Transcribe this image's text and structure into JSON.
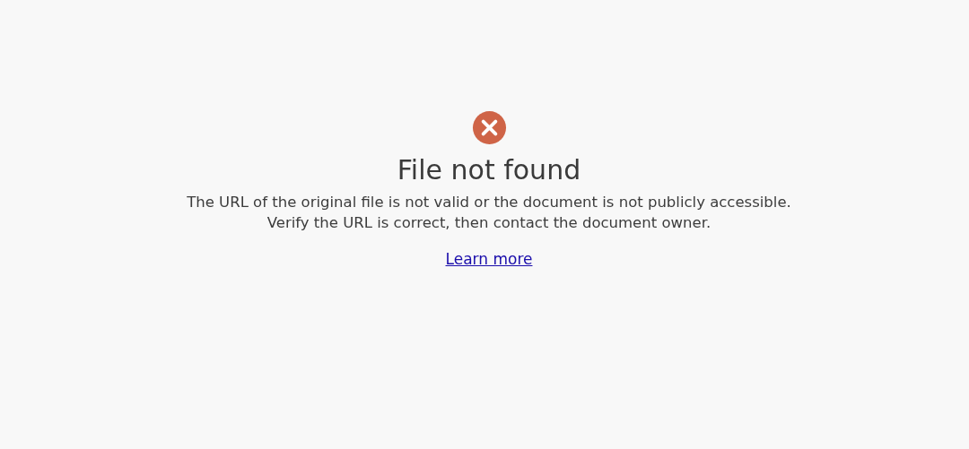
{
  "error": {
    "title": "File not found",
    "message": [
      "The URL of the original file is not valid or the document is not publicly accessible.",
      "Verify the URL is correct, then contact the document owner."
    ],
    "link": "Learn more"
  }
}
